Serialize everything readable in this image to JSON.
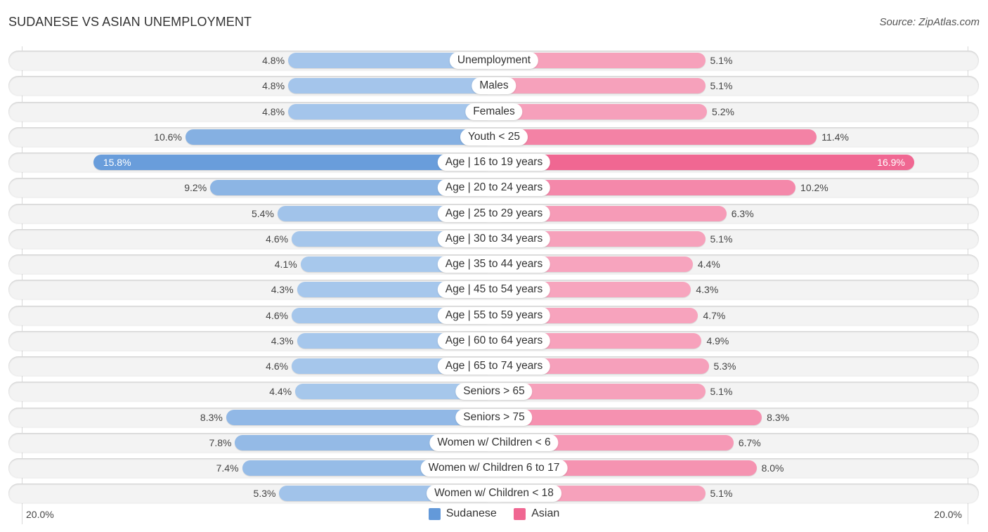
{
  "header": {
    "title": "SUDANESE VS ASIAN UNEMPLOYMENT",
    "source": "Source: ZipAtlas.com"
  },
  "colors": {
    "sudanese_strong": "#6399d9",
    "sudanese_light": "#a8c8ec",
    "asian_strong": "#f06792",
    "asian_light": "#f7a6bf"
  },
  "chart_data": {
    "type": "bar",
    "orientation": "diverging-horizontal",
    "title": "SUDANESE VS ASIAN UNEMPLOYMENT",
    "categories": [
      "Unemployment",
      "Males",
      "Females",
      "Youth < 25",
      "Age | 16 to 19 years",
      "Age | 20 to 24 years",
      "Age | 25 to 29 years",
      "Age | 30 to 34 years",
      "Age | 35 to 44 years",
      "Age | 45 to 54 years",
      "Age | 55 to 59 years",
      "Age | 60 to 64 years",
      "Age | 65 to 74 years",
      "Seniors > 65",
      "Seniors > 75",
      "Women w/ Children < 6",
      "Women w/ Children 6 to 17",
      "Women w/ Children < 18"
    ],
    "series": [
      {
        "name": "Sudanese",
        "side": "left",
        "values": [
          4.8,
          4.8,
          4.8,
          10.6,
          15.8,
          9.2,
          5.4,
          4.6,
          4.1,
          4.3,
          4.6,
          4.3,
          4.6,
          4.4,
          8.3,
          7.8,
          7.4,
          5.3
        ],
        "labels": [
          "4.8%",
          "4.8%",
          "4.8%",
          "10.6%",
          "15.8%",
          "9.2%",
          "5.4%",
          "4.6%",
          "4.1%",
          "4.3%",
          "4.6%",
          "4.3%",
          "4.6%",
          "4.4%",
          "8.3%",
          "7.8%",
          "7.4%",
          "5.3%"
        ]
      },
      {
        "name": "Asian",
        "side": "right",
        "values": [
          5.1,
          5.1,
          5.2,
          11.4,
          16.9,
          10.2,
          6.3,
          5.1,
          4.4,
          4.3,
          4.7,
          4.9,
          5.3,
          5.1,
          8.3,
          6.7,
          8.0,
          5.1
        ],
        "labels": [
          "5.1%",
          "5.1%",
          "5.2%",
          "11.4%",
          "16.9%",
          "10.2%",
          "6.3%",
          "5.1%",
          "4.4%",
          "4.3%",
          "4.7%",
          "4.9%",
          "5.3%",
          "5.1%",
          "8.3%",
          "6.7%",
          "8.0%",
          "5.1%"
        ]
      }
    ],
    "xlim": [
      0,
      20.0
    ],
    "axis_labels": {
      "left": "20.0%",
      "right": "20.0%"
    },
    "legend": [
      "Sudanese",
      "Asian"
    ],
    "legend_position": "bottom-center",
    "unit": "%"
  }
}
